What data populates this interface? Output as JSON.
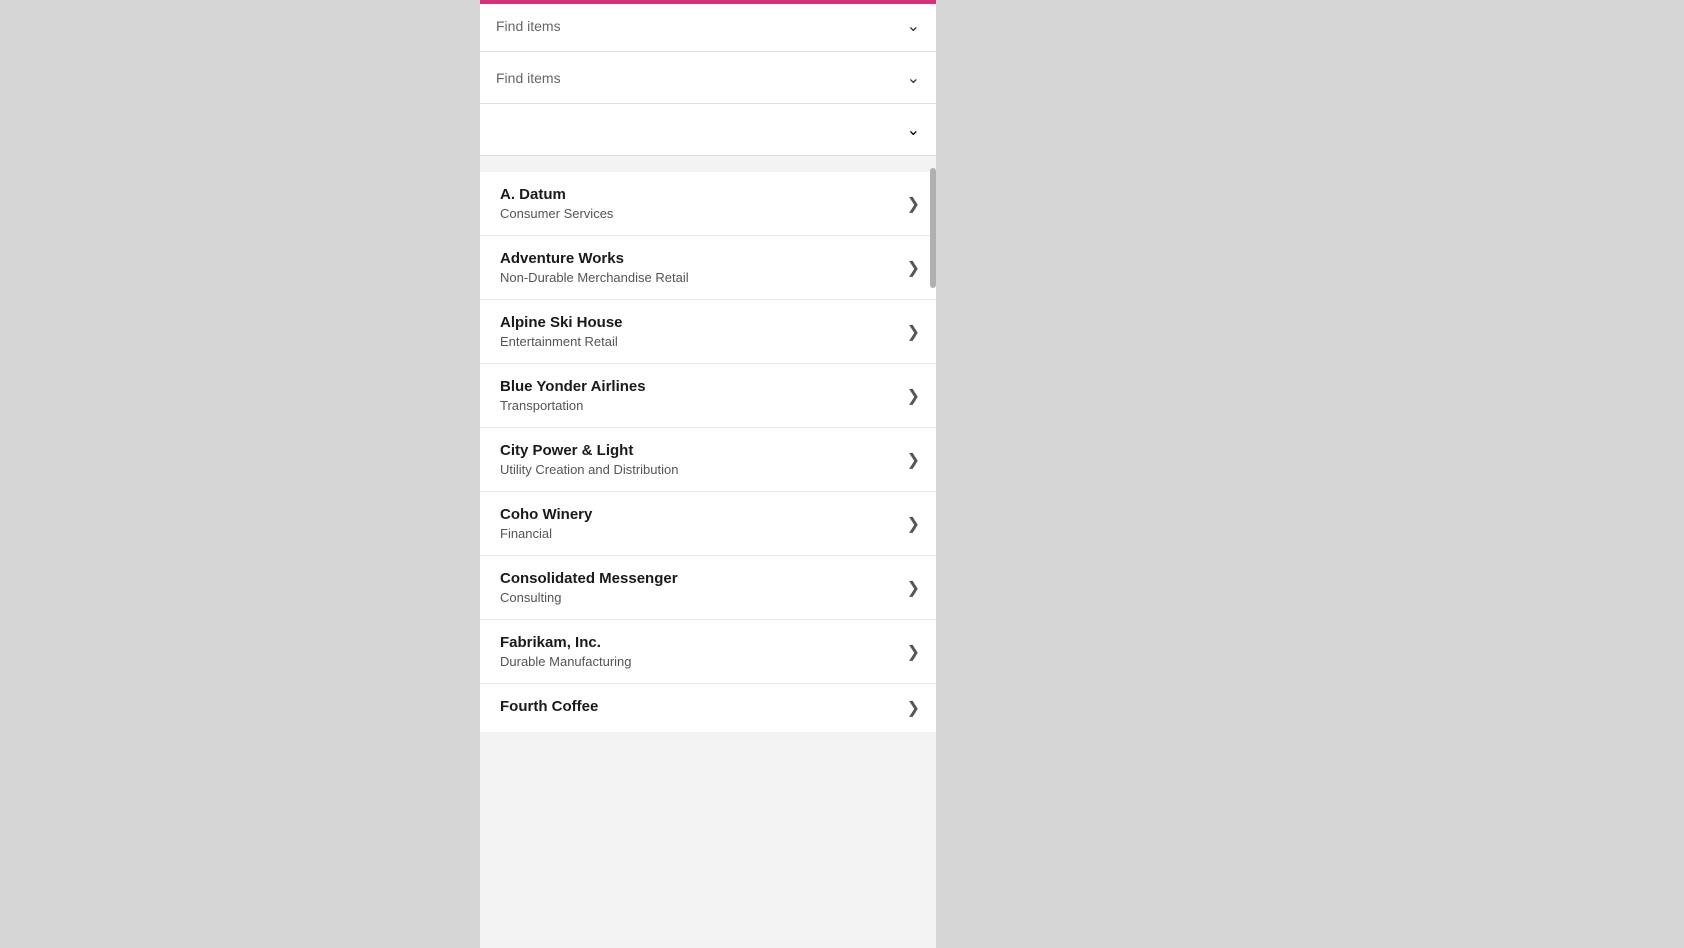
{
  "filters": [
    {
      "label": "Find items",
      "id": "filter-1"
    },
    {
      "label": "Find items",
      "id": "filter-2"
    },
    {
      "label": "",
      "id": "filter-3"
    }
  ],
  "items": [
    {
      "name": "A. Datum",
      "sub": "Consumer Services"
    },
    {
      "name": "Adventure Works",
      "sub": "Non-Durable Merchandise Retail"
    },
    {
      "name": "Alpine Ski House",
      "sub": "Entertainment Retail"
    },
    {
      "name": "Blue Yonder Airlines",
      "sub": "Transportation"
    },
    {
      "name": "City Power & Light",
      "sub": "Utility Creation and Distribution"
    },
    {
      "name": "Coho Winery",
      "sub": "Financial"
    },
    {
      "name": "Consolidated Messenger",
      "sub": "Consulting"
    },
    {
      "name": "Fabrikam, Inc.",
      "sub": "Durable Manufacturing"
    },
    {
      "name": "Fourth Coffee",
      "sub": ""
    }
  ],
  "chevron_down": "⌵",
  "chevron_right": "❯"
}
